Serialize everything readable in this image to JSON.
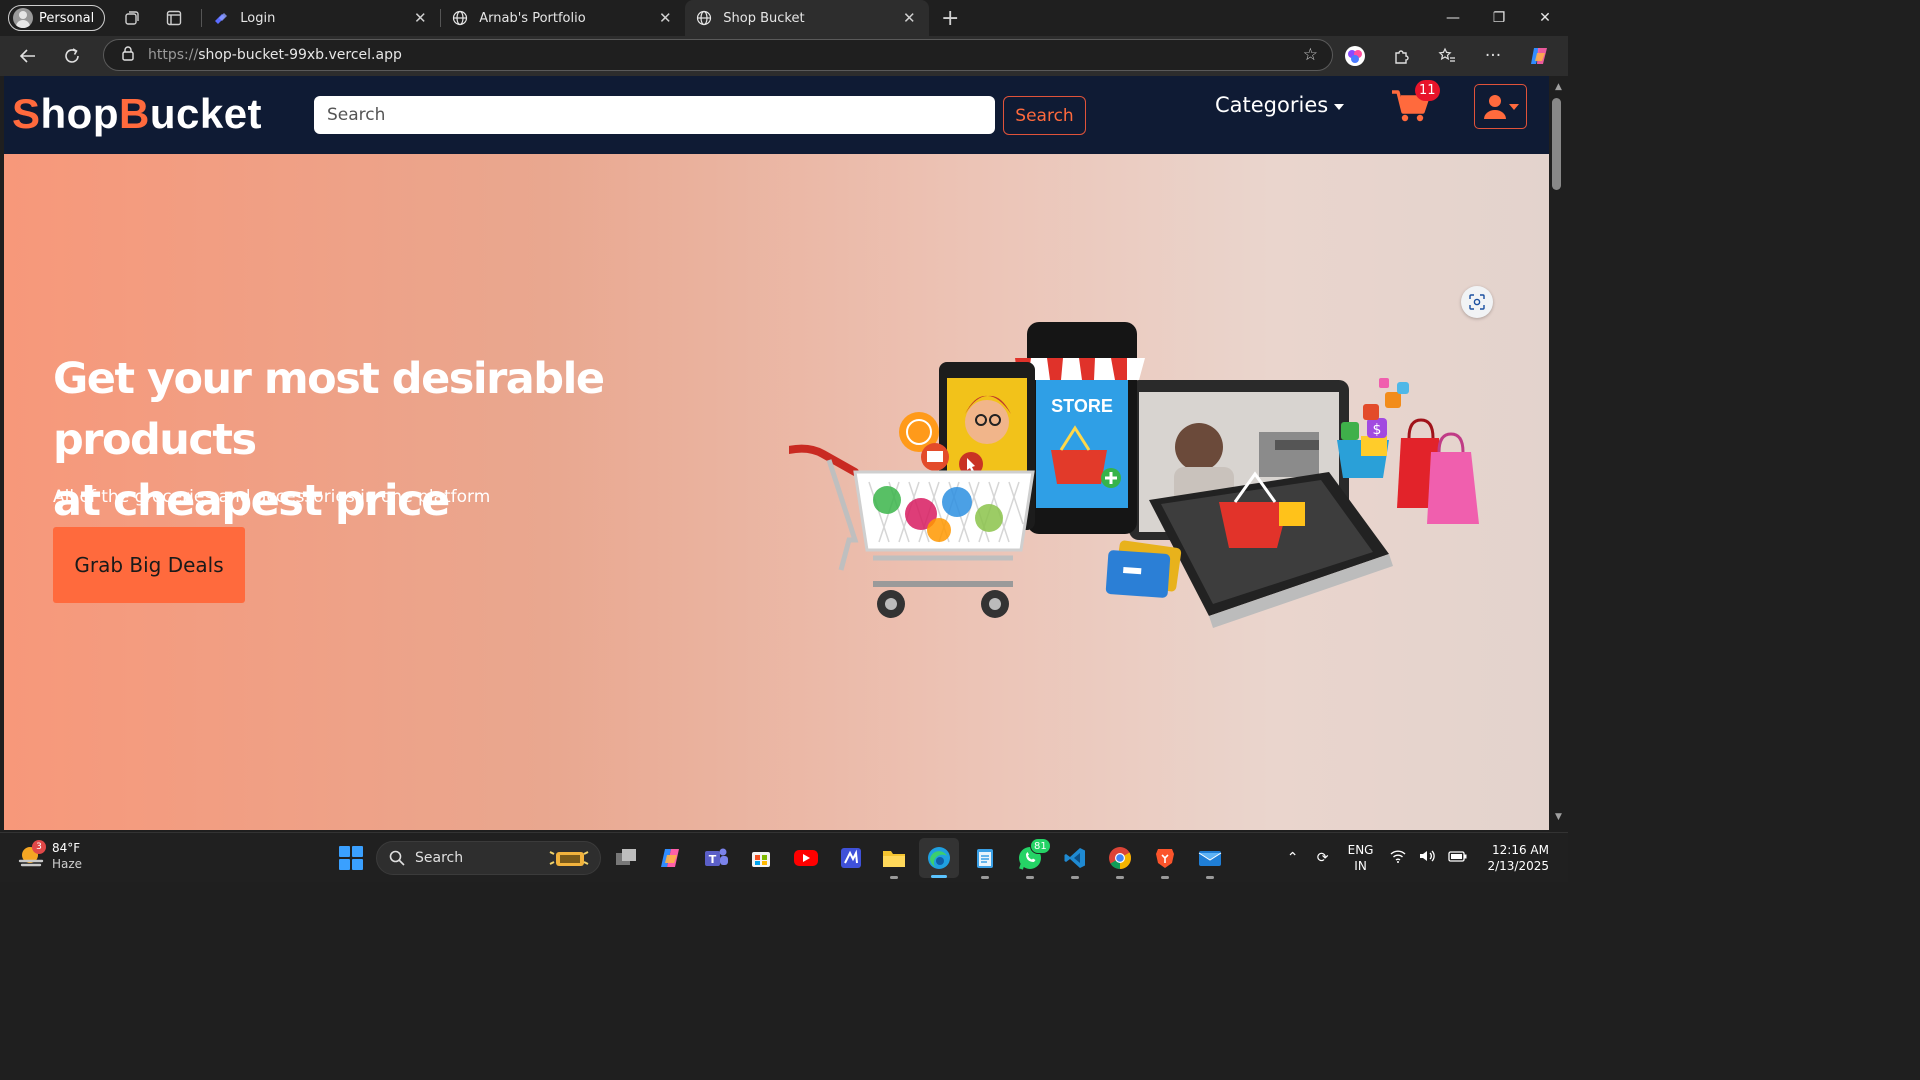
{
  "browser": {
    "profile_label": "Personal",
    "tabs": [
      {
        "title": "Login"
      },
      {
        "title": "Arnab's Portfolio"
      },
      {
        "title": "Shop Bucket"
      }
    ],
    "url_protocol": "https://",
    "url_host": "shop-bucket-99xb.vercel.app"
  },
  "site": {
    "logo_part1": "S",
    "logo_part2": "hop",
    "logo_part3": "B",
    "logo_part4": "ucket",
    "search_placeholder": "Search",
    "search_button": "Search",
    "categories_label": "Categories",
    "cart_count": "11",
    "accent_color": "#ff6a3d",
    "nav_bg": "#0f1b34"
  },
  "hero": {
    "title_line1": "Get your most desirable products",
    "title_line2": "at cheapest price",
    "subtitle": "All of the groceries and accessories in one platform",
    "cta_label": "Grab Big Deals",
    "store_sign": "STORE"
  },
  "taskbar": {
    "weather_temp": "84°F",
    "weather_desc": "Haze",
    "weather_badge": "3",
    "search_label": "Search",
    "whatsapp_badge": "81",
    "lang_line1": "ENG",
    "lang_line2": "IN",
    "time": "12:16 AM",
    "date": "2/13/2025"
  }
}
